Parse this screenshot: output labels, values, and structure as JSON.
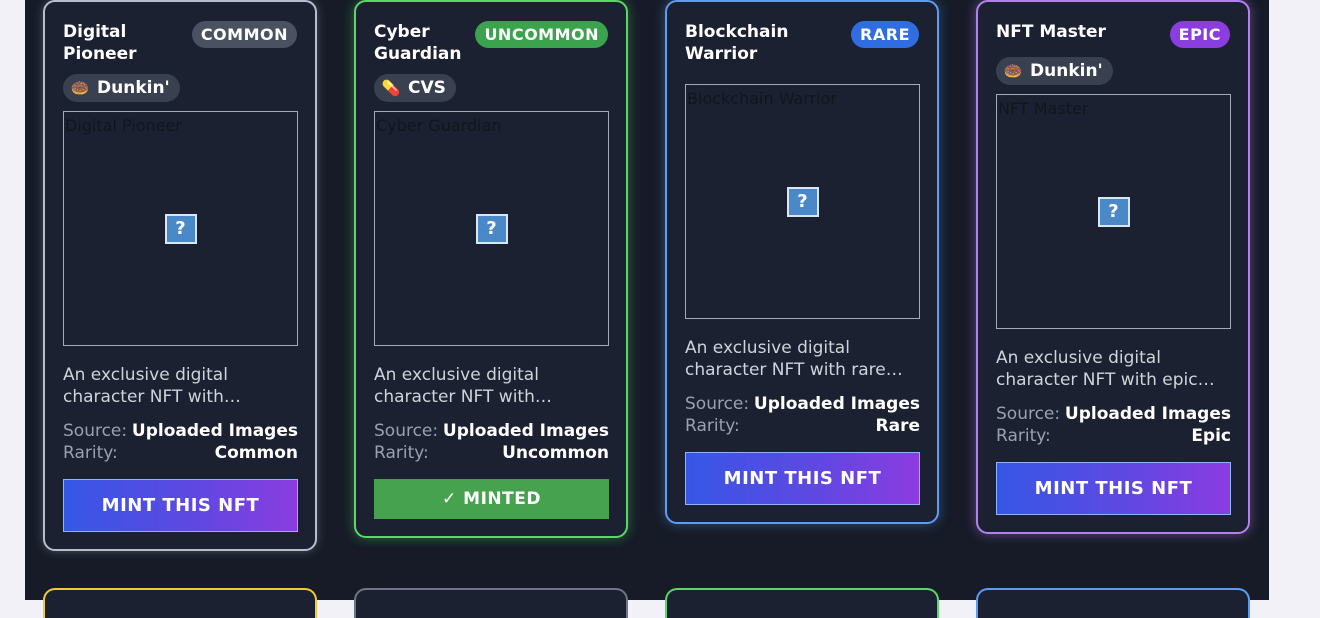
{
  "cards": [
    {
      "title": "Digital Pioneer",
      "rarity_badge": "COMMON",
      "brand": {
        "name": "Dunkin'",
        "icon": "🍩",
        "icon_name": "donut-icon"
      },
      "image_alt": "Digital Pioneer",
      "image_icon": "?",
      "description": "An exclusive digital character NFT with…",
      "source_label": "Source:",
      "source_value": "Uploaded Images",
      "rarity_label": "Rarity:",
      "rarity_value": "Common",
      "action_label": "MINT THIS NFT",
      "minted": false
    },
    {
      "title": "Cyber Guardian",
      "rarity_badge": "UNCOMMON",
      "brand": {
        "name": "CVS",
        "icon": "💊",
        "icon_name": "pill-icon"
      },
      "image_alt": "Cyber Guardian",
      "image_icon": "?",
      "description": "An exclusive digital character NFT with…",
      "source_label": "Source:",
      "source_value": "Uploaded Images",
      "rarity_label": "Rarity:",
      "rarity_value": "Uncommon",
      "action_label": "✓ MINTED",
      "minted": true
    },
    {
      "title": "Blockchain Warrior",
      "rarity_badge": "RARE",
      "brand": null,
      "image_alt": "Blockchain Warrior",
      "image_icon": "?",
      "description": "An exclusive digital character NFT with rare…",
      "source_label": "Source:",
      "source_value": "Uploaded Images",
      "rarity_label": "Rarity:",
      "rarity_value": "Rare",
      "action_label": "MINT THIS NFT",
      "minted": false
    },
    {
      "title": "NFT Master",
      "rarity_badge": "EPIC",
      "brand": {
        "name": "Dunkin'",
        "icon": "🍩",
        "icon_name": "donut-icon"
      },
      "image_alt": "NFT Master",
      "image_icon": "?",
      "description": "An exclusive digital character NFT with epic…",
      "source_label": "Source:",
      "source_value": "Uploaded Images",
      "rarity_label": "Rarity:",
      "rarity_value": "Epic",
      "action_label": "MINT THIS NFT",
      "minted": false
    }
  ],
  "colors": {
    "common": "#b8bfcc",
    "uncommon": "#5ad766",
    "rare": "#5e9bf2",
    "epic": "#b480ee",
    "legendary": "#f0c93a",
    "panel_bg": "#161b27"
  }
}
